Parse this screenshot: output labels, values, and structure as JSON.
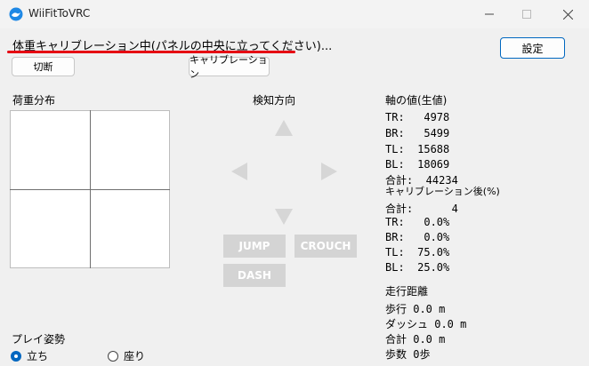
{
  "window": {
    "title": "WiiFitToVRC"
  },
  "status_text": "体重キャリブレーション中(パネルの中央に立ってください)...",
  "buttons": {
    "settings": "設定",
    "disconnect": "切断",
    "calibrate": "キャリブレーション"
  },
  "weight_distribution": {
    "label": "荷重分布"
  },
  "direction": {
    "label": "検知方向",
    "jump": "JUMP",
    "crouch": "CROUCH",
    "dash": "DASH"
  },
  "axis_values": {
    "label": "軸の値(生値)",
    "tr": "TR:   4978",
    "br": "BR:   5499",
    "tl": "TL:  15688",
    "bl": "BL:  18069",
    "total": "合計:  44234"
  },
  "calibrated": {
    "label": "キャリブレーション後(%)",
    "total": "合計:      4",
    "tr": "TR:   0.0%",
    "br": "BR:   0.0%",
    "tl": "TL:  75.0%",
    "bl": "BL:  25.0%"
  },
  "distance": {
    "label": "走行距離",
    "walk": "歩行 0.0 m",
    "dash": "ダッシュ 0.0 m",
    "total": "合計 0.0 m",
    "steps": "歩数 0歩"
  },
  "play_posture": {
    "label": "プレイ姿勢",
    "options": [
      "立ち",
      "座り"
    ],
    "selected": "立ち"
  },
  "colors": {
    "accent": "#0067c0",
    "underline": "#e60012",
    "disabled": "#d4d4d4"
  }
}
